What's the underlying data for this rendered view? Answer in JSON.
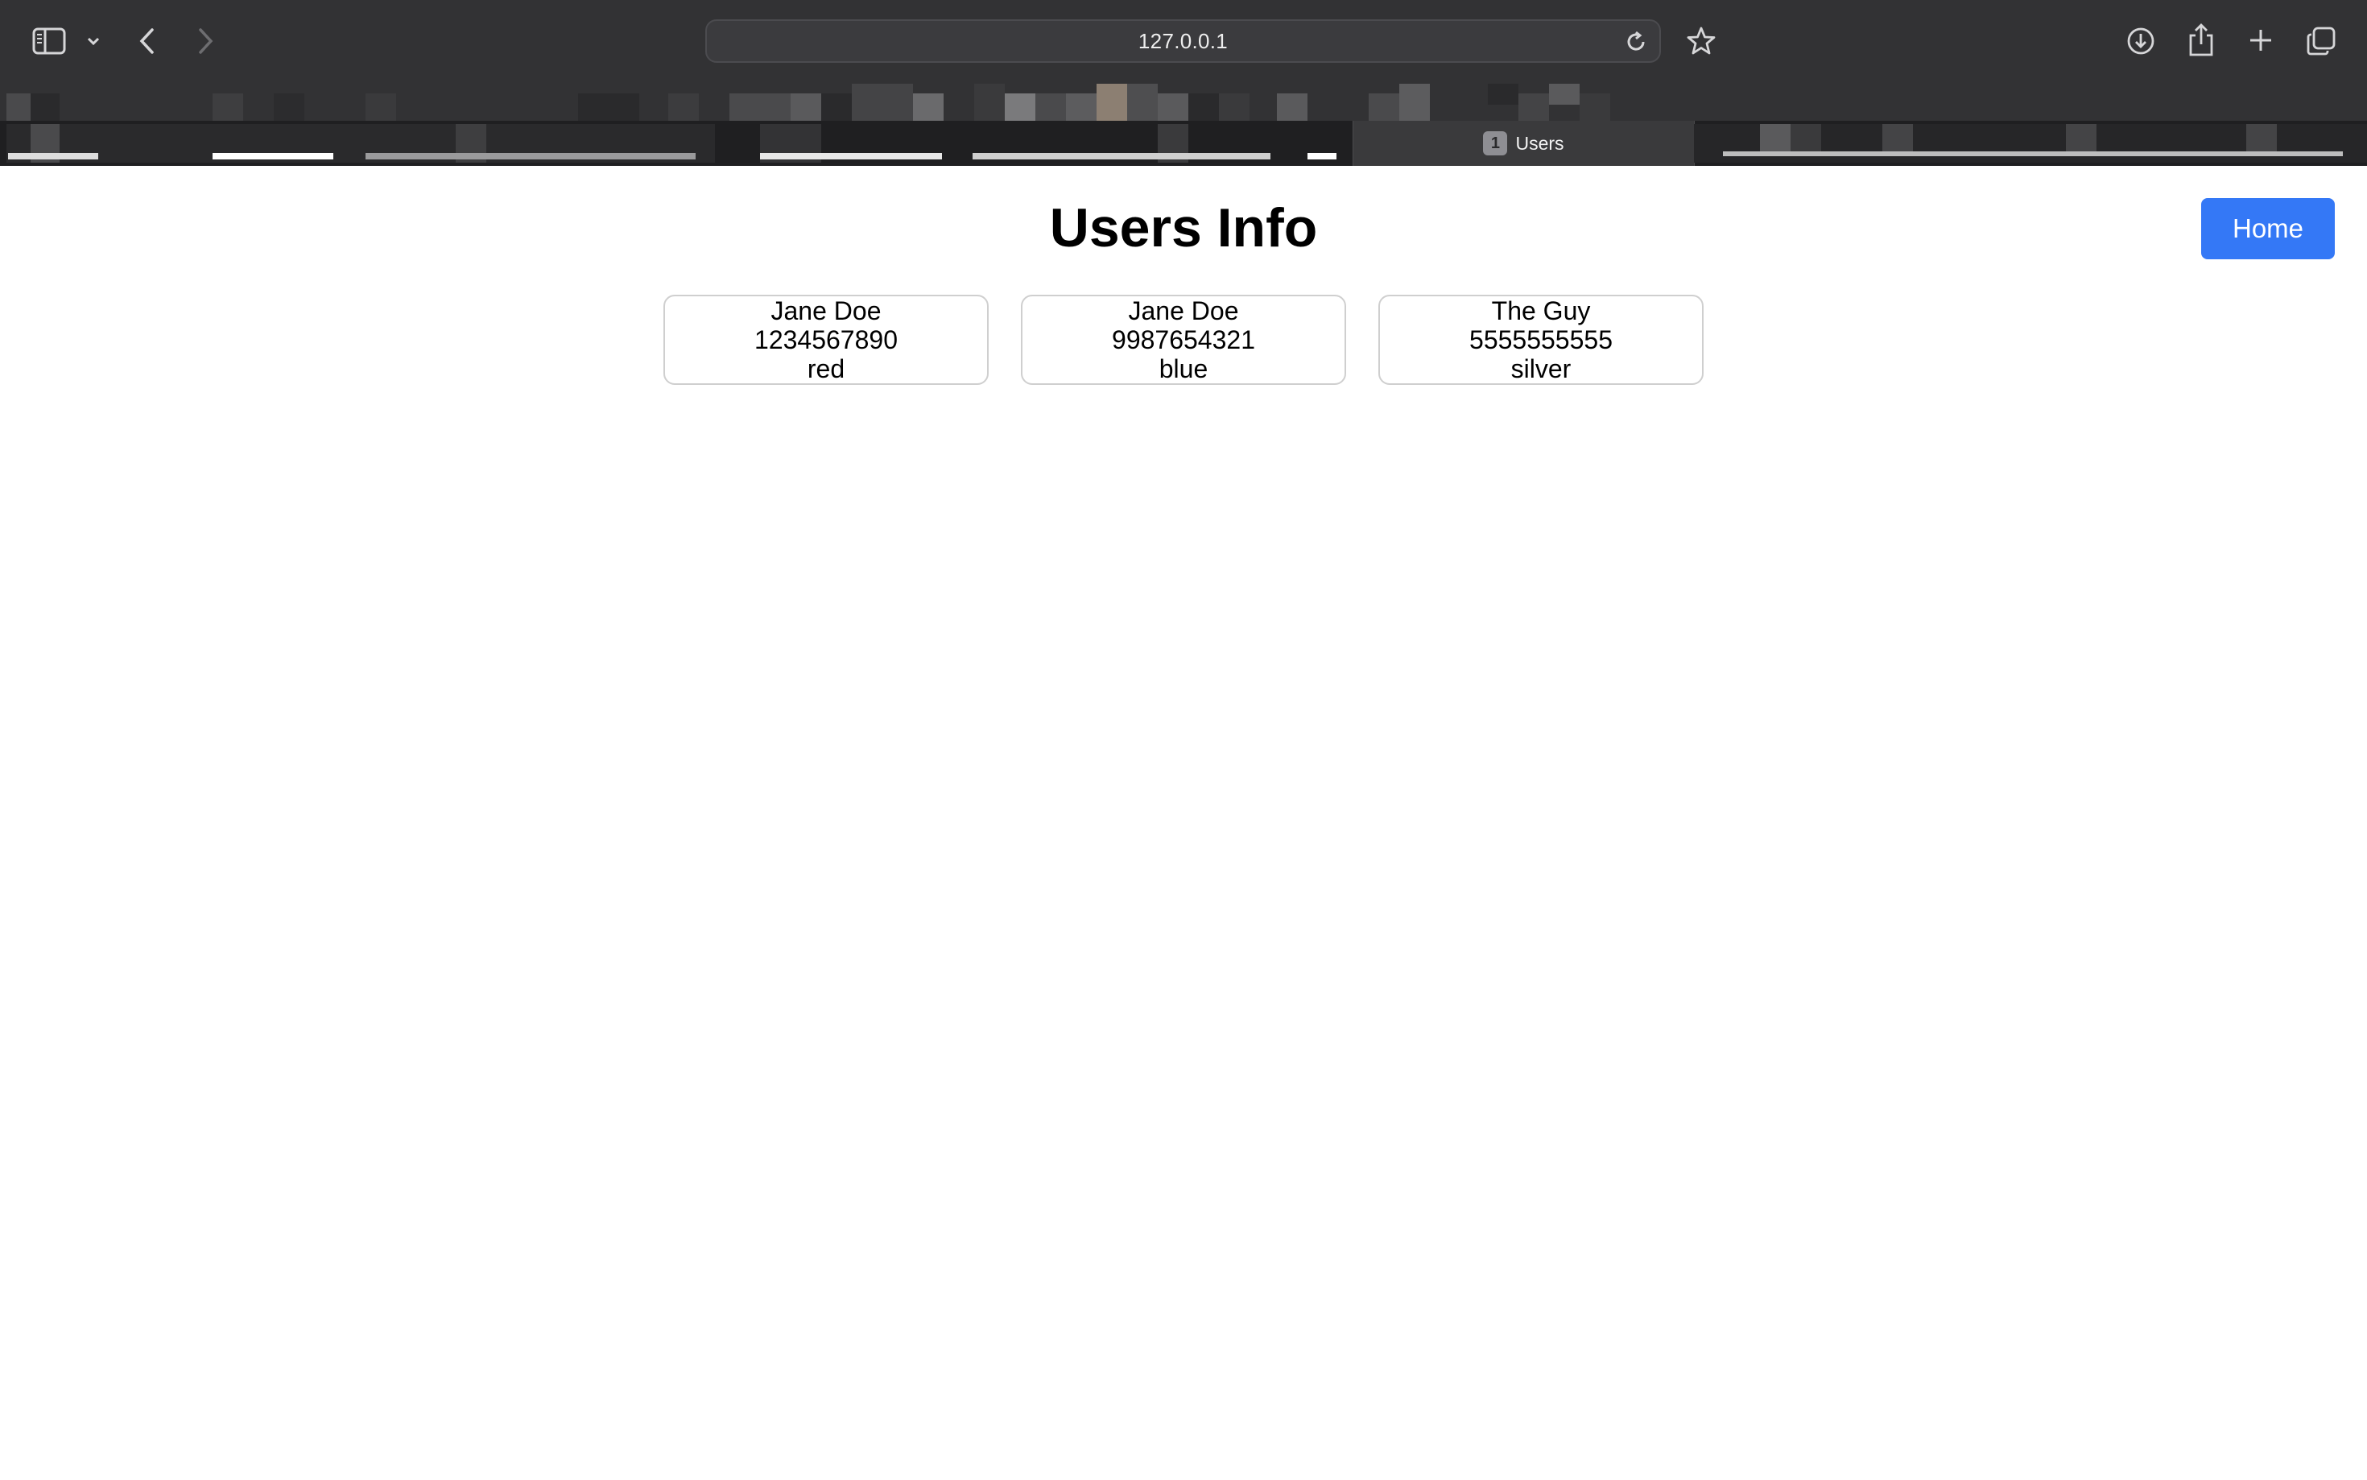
{
  "browser": {
    "address": "127.0.0.1",
    "active_tab": {
      "badge": "1",
      "title": "Users"
    },
    "icons": {
      "sidebar": "sidebar-icon",
      "sidebar_menu": "chevron-down-icon",
      "back": "back-icon",
      "forward": "forward-icon",
      "reload": "reload-icon",
      "bookmark": "star-icon",
      "downloads": "download-icon",
      "share": "share-icon",
      "new_tab": "plus-icon",
      "tab_overview": "tabs-overview-icon"
    }
  },
  "page": {
    "title": "Users Info",
    "home_button": "Home",
    "users": [
      {
        "name": "Jane Doe",
        "phone": "1234567890",
        "color": "red"
      },
      {
        "name": "Jane Doe",
        "phone": "9987654321",
        "color": "blue"
      },
      {
        "name": "The Guy",
        "phone": "5555555555",
        "color": "silver"
      }
    ]
  },
  "colors": {
    "chrome_bg": "#323234",
    "button_bg": "#3478f6",
    "card_border": "#cfcfcf"
  }
}
